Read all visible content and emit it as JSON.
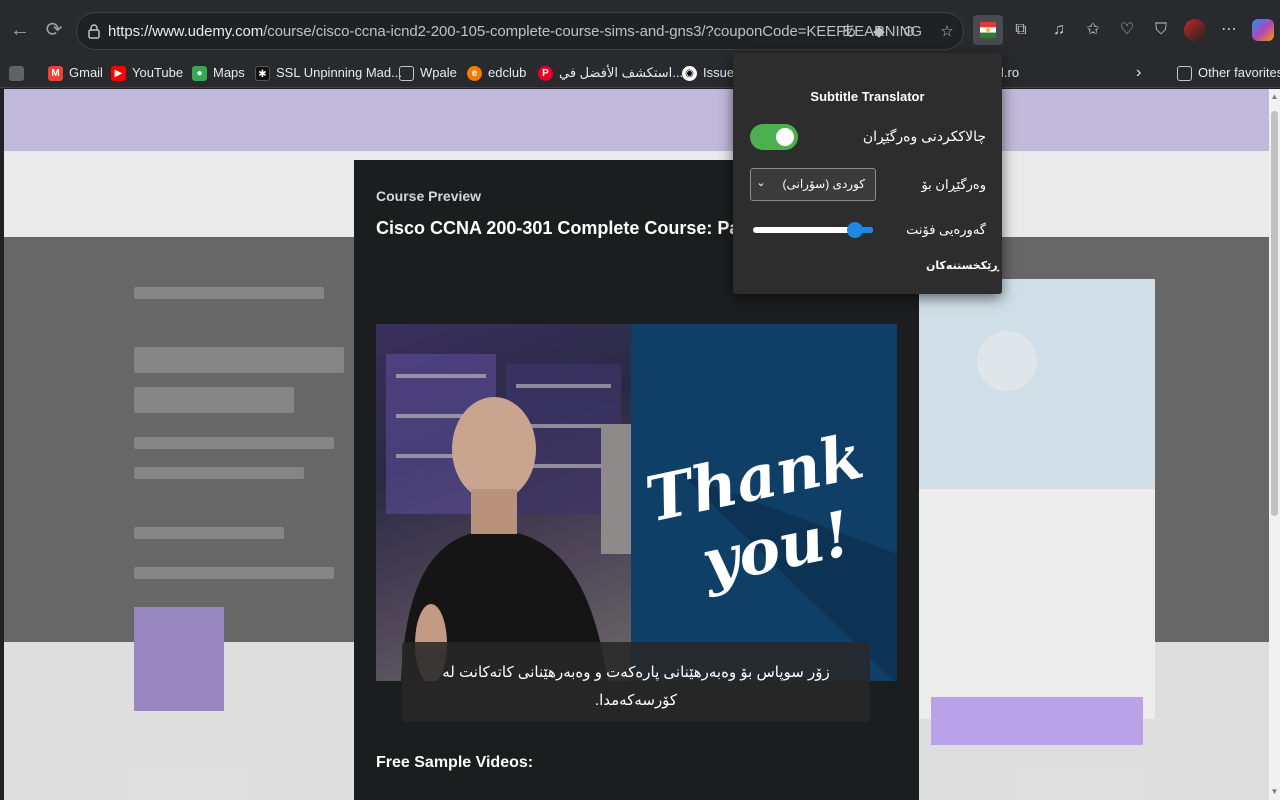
{
  "browser": {
    "url_host": "https://www.udemy.com",
    "url_path": "/course/cisco-ccna-icnd2-200-105-complete-course-sims-and-gns3/?couponCode=KEEPLEARNING",
    "bookmarks": [
      {
        "label": "Gmail",
        "icon": "gmail-icon",
        "color": "#ea4335"
      },
      {
        "label": "YouTube",
        "icon": "youtube-icon",
        "color": "#ff0000"
      },
      {
        "label": "Maps",
        "icon": "maps-icon",
        "color": "#34a853"
      },
      {
        "label": "SSL Unpinning Mad...",
        "icon": "ssl-icon",
        "color": "#111111"
      },
      {
        "label": "Wpale",
        "icon": "folder-icon",
        "color": ""
      },
      {
        "label": "edclub",
        "icon": "edclub-icon",
        "color": "#f57c00"
      },
      {
        "label": "استكشف الأفضل في...",
        "icon": "pinterest-icon",
        "color": "#e60023"
      },
      {
        "label": "Issues",
        "icon": "github-icon",
        "color": "#ffffff"
      },
      {
        "label": "l.ro",
        "icon": "",
        "color": ""
      },
      {
        "label": "Other favorites",
        "icon": "folder-icon",
        "color": ""
      }
    ]
  },
  "modal": {
    "eyebrow": "Course Preview",
    "title": "Cisco CCNA 200-301 Complete Course: Packe",
    "video_text": "Thank you!",
    "subtitle": "زۆر سوپاس بۆ وەبەرهێنانی پارەکەت و وەبەرهێنانی کاتەکانت لە کۆرسەکەمدا.",
    "free_sample": "Free Sample Videos:"
  },
  "popup": {
    "title": "Subtitle Translator",
    "enable_label": "چالاککردنی وەرگێڕان",
    "enabled": true,
    "translate_to_label": "وەرگێڕان بۆ",
    "language_value": "کوردی (سۆرانی)",
    "font_size_label": "گەورەیی فۆنت",
    "font_size_level": 0.85,
    "reset_label": "ڕێکخستنەکان"
  },
  "colors": {
    "toggle_on": "#4caf50",
    "slider_accent": "#1e88e5",
    "popup_bg": "#2d2d2d",
    "modal_bg": "#1c1d1f"
  }
}
